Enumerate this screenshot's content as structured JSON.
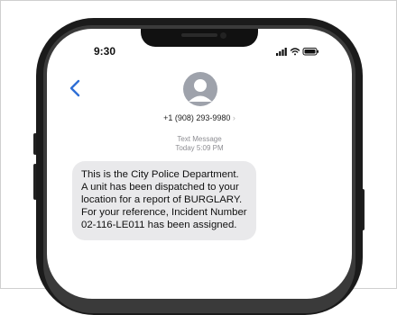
{
  "status_bar": {
    "time": "9:30"
  },
  "conversation": {
    "contact_number": "+1 (908) 293-9980",
    "contact_chevron": "›",
    "meta_line1": "Text Message",
    "meta_line2": "Today 5:09 PM"
  },
  "messages": [
    {
      "text": "This is the City Police Department. A unit has been dispatched to your location for a report of BURGLARY. For your reference, Incident Number 02-116-LE011 has been assigned."
    }
  ],
  "icons": {
    "back": "chevron-left-icon",
    "avatar": "person-icon",
    "signal": "signal-icon",
    "wifi": "wifi-icon",
    "battery": "battery-icon"
  },
  "colors": {
    "accent": "#2f6fd6",
    "bubble": "#e9e9eb",
    "meta_text": "#8e8e93"
  }
}
